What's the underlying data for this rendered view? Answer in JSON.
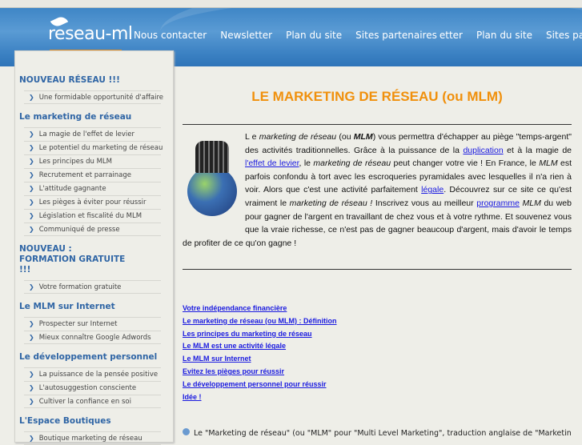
{
  "header": {
    "logo": "reseau-ml",
    "nav": [
      "Nous contacter",
      "Newsletter",
      "Plan du site",
      "Sites partenaires",
      "etter",
      "Plan du site",
      "Sites partenaires"
    ]
  },
  "sidebar": [
    {
      "heading": "NOUVEAU RÉSEAU !!!",
      "items": [
        "Une formidable opportunité d'affaire"
      ]
    },
    {
      "heading": "Le marketing de réseau",
      "items": [
        "La magie de l'effet de levier",
        "Le potentiel du marketing de réseau",
        "Les principes du MLM",
        "Recrutement et parrainage",
        "L'attitude gagnante",
        "Les pièges à éviter pour réussir",
        "Législation et fiscalité du MLM",
        "Communiqué de presse"
      ]
    },
    {
      "heading": "NOUVEAU : FORMATION GRATUITE !!!",
      "items": [
        "Votre formation gratuite"
      ]
    },
    {
      "heading": "Le MLM sur Internet",
      "items": [
        "Prospecter sur Internet",
        "Mieux connaître Google Adwords"
      ]
    },
    {
      "heading": "Le développement personnel",
      "items": [
        "La puissance de la pensée positive",
        "L'autosuggestion consciente",
        "Cultiver la confiance en soi"
      ]
    },
    {
      "heading": "L'Espace Boutiques",
      "items": [
        "Boutique marketing de réseau"
      ]
    }
  ],
  "main": {
    "title": "LE MARKETING DE RÉSEAU (ou MLM)",
    "intro": {
      "t1": "L e ",
      "i1": "marketing de réseau",
      "t2": " (ou ",
      "i2": "MLM",
      "t3": ") vous permettra d'échapper au piège \"temps-argent\" des activités traditionnelles. Grâce à la puissance de la ",
      "l1": "duplication",
      "t4": " et à la magie de ",
      "l2": "l'effet de levier",
      "t5": ", le ",
      "i3": "marketing de réseau",
      "t6": " peut changer votre vie ! En France, le ",
      "i4": "MLM",
      "t7": " est parfois confondu à tort avec les escroqueries pyramidales avec lesquelles il n'a rien à voir. Alors que c'est une activité parfaitement ",
      "l3": "légale",
      "t8": ". Découvrez sur ce site ce qu'est vraiment le ",
      "i5": "marketing de réseau !",
      "t9": " Inscrivez vous au meilleur ",
      "l4": "programme",
      "i6": " MLM",
      "t10": " du web pour gagner de l'argent en travaillant de chez vous et à votre rythme. Et souvenez vous que la vraie richesse, ce n'est pas de gagner beaucoup d'argent, mais d'avoir le temps de profiter de ce qu'on gagne !"
    },
    "links": [
      "Votre indépendance financière",
      "Le marketing de réseau (ou MLM) : Définition",
      "Les principes du marketing de réseau",
      "Le MLM est une activité légale",
      "Le MLM sur Internet",
      "Evitez les pièges pour réussir",
      "Le développement personnel pour réussir",
      "Idée !"
    ],
    "footer": "Le \"Marketing de réseau\" (ou \"MLM\" pour \"Multi Level Marketing\", traduction anglaise de \"Marketing Multi"
  }
}
